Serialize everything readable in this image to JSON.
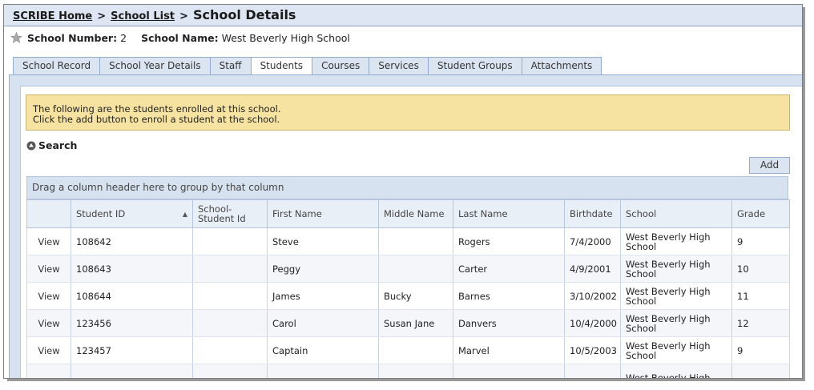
{
  "breadcrumb": {
    "home": "SCRIBE Home",
    "separator": ">",
    "list": "School List",
    "current": "School Details"
  },
  "school_info": {
    "number_label": "School Number:",
    "number_value": "2",
    "name_label": "School Name:",
    "name_value": "West Beverly High School"
  },
  "tabs": [
    {
      "label": "School Record",
      "active": false
    },
    {
      "label": "School Year Details",
      "active": false
    },
    {
      "label": "Staff",
      "active": false
    },
    {
      "label": "Students",
      "active": true
    },
    {
      "label": "Courses",
      "active": false
    },
    {
      "label": "Services",
      "active": false
    },
    {
      "label": "Student Groups",
      "active": false
    },
    {
      "label": "Attachments",
      "active": false
    }
  ],
  "notice": {
    "line1": "The following are the students enrolled at this school.",
    "line2": "Click the add button to enroll a student at the school."
  },
  "search": {
    "label": "Search"
  },
  "add_button": "Add",
  "group_bar": "Drag a column header here to group by that column",
  "grid": {
    "columns": [
      "",
      "Student ID",
      "School-Student Id",
      "First Name",
      "Middle Name",
      "Last Name",
      "Birthdate",
      "School",
      "Grade"
    ],
    "sorted_column": "Student ID",
    "sort_direction": "ascending",
    "rows": [
      {
        "action": "View",
        "student_id": "108642",
        "school_student_id": "",
        "first_name": "Steve",
        "middle_name": "",
        "last_name": "Rogers",
        "birthdate": "7/4/2000",
        "school": "West Beverly High School",
        "grade": "9"
      },
      {
        "action": "View",
        "student_id": "108643",
        "school_student_id": "",
        "first_name": "Peggy",
        "middle_name": "",
        "last_name": "Carter",
        "birthdate": "4/9/2001",
        "school": "West Beverly High School",
        "grade": "10"
      },
      {
        "action": "View",
        "student_id": "108644",
        "school_student_id": "",
        "first_name": "James",
        "middle_name": "Bucky",
        "last_name": "Barnes",
        "birthdate": "3/10/2002",
        "school": "West Beverly High School",
        "grade": "11"
      },
      {
        "action": "View",
        "student_id": "123456",
        "school_student_id": "",
        "first_name": "Carol",
        "middle_name": "Susan Jane",
        "last_name": "Danvers",
        "birthdate": "10/4/2000",
        "school": "West Beverly High School",
        "grade": "12"
      },
      {
        "action": "View",
        "student_id": "123457",
        "school_student_id": "",
        "first_name": "Captain",
        "middle_name": "",
        "last_name": "Marvel",
        "birthdate": "10/5/2003",
        "school": "West Beverly High School",
        "grade": "9"
      },
      {
        "action": "",
        "student_id": "",
        "school_student_id": "",
        "first_name": "",
        "middle_name": "",
        "last_name": "",
        "birthdate": "",
        "school": "West Beverly High",
        "grade": ""
      }
    ]
  },
  "colors": {
    "titlebar_bg": "#dde6f2",
    "tab_bg": "#dbe5f1",
    "panel_bg": "#d7e2f0",
    "notice_bg": "#f6e3a2"
  }
}
